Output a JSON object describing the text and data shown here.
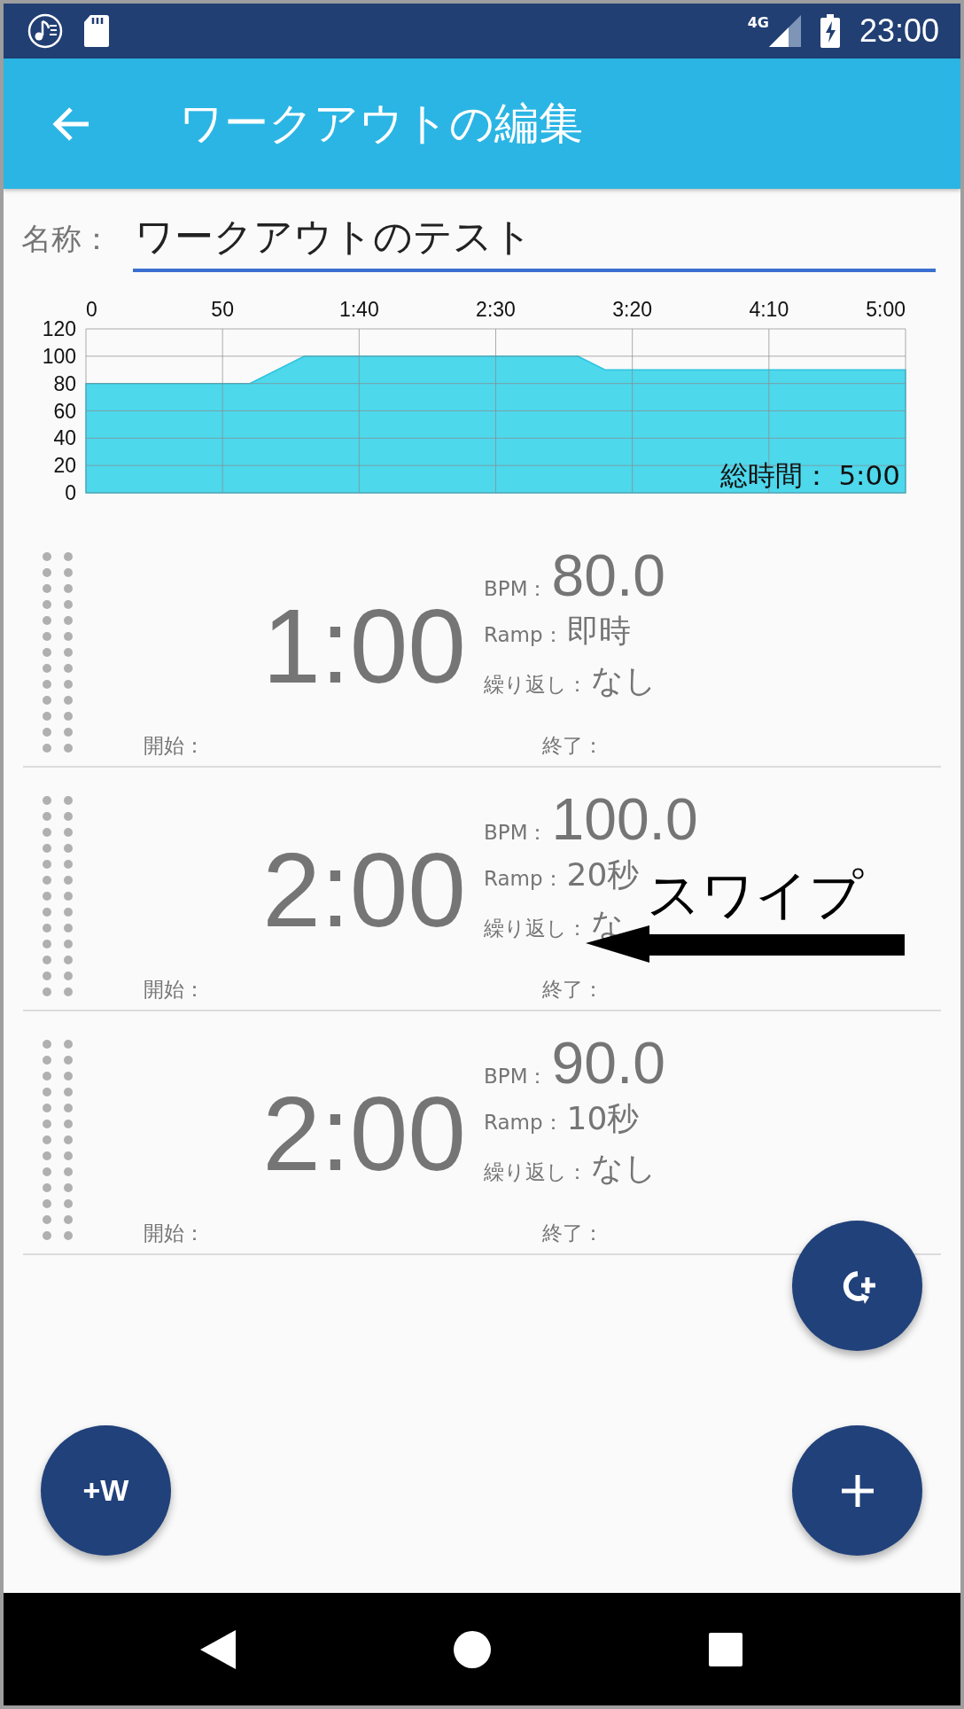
{
  "status_bar": {
    "network": "4G",
    "time": "23:00"
  },
  "app_bar": {
    "title": "ワークアウトの編集"
  },
  "name_field": {
    "label": "名称：",
    "value": "ワークアウトのテスト"
  },
  "chart": {
    "total_time": "総時間： 5:00",
    "chart_data": {
      "type": "area",
      "x": [
        0,
        60,
        80,
        180,
        190,
        300
      ],
      "grid": true,
      "series": [
        {
          "color": "#4dd8ec",
          "values": [
            80,
            80,
            100,
            100,
            90,
            90
          ]
        }
      ],
      "xlim": [
        0,
        300
      ],
      "ylim": [
        0,
        120
      ],
      "xticks": [
        {
          "value": 0,
          "label": "0"
        },
        {
          "value": 50,
          "label": "50"
        },
        {
          "value": 100,
          "label": "1:40"
        },
        {
          "value": 150,
          "label": "2:30"
        },
        {
          "value": 200,
          "label": "3:20"
        },
        {
          "value": 250,
          "label": "4:10"
        },
        {
          "value": 300,
          "label": "5:00"
        }
      ],
      "yticks": [
        0,
        20,
        40,
        60,
        80,
        100,
        120
      ]
    }
  },
  "segments": [
    {
      "time": "1:00",
      "bpm_label": "BPM：",
      "bpm": "80.0",
      "ramp_label": "Ramp：",
      "ramp": "即時",
      "repeat_label": "繰り返し：",
      "repeat": "なし",
      "start_label": "開始：",
      "end_label": "終了："
    },
    {
      "time": "2:00",
      "bpm_label": "BPM：",
      "bpm": "100.0",
      "ramp_label": "Ramp：",
      "ramp": "20秒",
      "repeat_label": "繰り返し：",
      "repeat": "な",
      "start_label": "開始：",
      "end_label": "終了："
    },
    {
      "time": "2:00",
      "bpm_label": "BPM：",
      "bpm": "90.0",
      "ramp_label": "Ramp：",
      "ramp": "10秒",
      "repeat_label": "繰り返し：",
      "repeat": "なし",
      "start_label": "開始：",
      "end_label": "終了："
    }
  ],
  "annotation": {
    "text": "スワイプ"
  },
  "fabs": [
    {
      "kind": "repeat-add"
    },
    {
      "kind": "text",
      "label": "+W"
    },
    {
      "kind": "add"
    }
  ]
}
